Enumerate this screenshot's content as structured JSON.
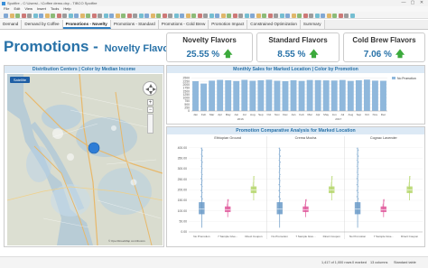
{
  "window": {
    "title": "Spotfire - C:\\Users\\...\\Coffee demo.dxp - TIBCO Spotfire",
    "controls": [
      "—",
      "▢",
      "✕"
    ]
  },
  "menu": [
    "File",
    "Edit",
    "View",
    "Insert",
    "Tools",
    "Help"
  ],
  "tabs": [
    {
      "label": "Demand"
    },
    {
      "label": "Demand by Coffee"
    },
    {
      "label": "Promotions - Novelty"
    },
    {
      "label": "Promotions - Standard"
    },
    {
      "label": "Promotions - Cold Brew"
    },
    {
      "label": "Promotion Impact"
    },
    {
      "label": "Constrained Optimization"
    },
    {
      "label": "Summary"
    }
  ],
  "page": {
    "title": "Promotions - ",
    "subtitle": "Novelty Flavors"
  },
  "kpis": [
    {
      "label": "Novelty Flavors",
      "value": "25.55 %"
    },
    {
      "label": "Standard Flavors",
      "value": "8.55 %"
    },
    {
      "label": "Cold Brew Flavors",
      "value": "7.06 %"
    }
  ],
  "map": {
    "title": "Distribution Centers | Color by Median Income",
    "layer_button": "Satellite",
    "attribution": "© OpenStreetMap contributors"
  },
  "sales_panel": {
    "title": "Monthly Sales for Marked Location | Color by Promotion"
  },
  "box_panel": {
    "title": "Promotion Comparative Analysis for Marked Location"
  },
  "chart_data": [
    {
      "type": "bar",
      "categories": [
        "Jan",
        "Feb",
        "Mar",
        "Apr",
        "May",
        "Jun",
        "Jul",
        "Aug",
        "Sep",
        "Oct",
        "Nov",
        "Dec",
        "Jan",
        "Feb",
        "Mar",
        "Apr",
        "May",
        "Jun",
        "Jul",
        "Aug",
        "Sep",
        "Oct",
        "Nov",
        "Dec"
      ],
      "year_labels": [
        "2016",
        "2017"
      ],
      "values": [
        2260,
        2080,
        2300,
        2360,
        2330,
        2270,
        2360,
        2290,
        2330,
        2370,
        2290,
        2260,
        2330,
        2280,
        2350,
        2340,
        2320,
        2310,
        2350,
        2280,
        2330,
        2380,
        2300,
        2290
      ],
      "yticks": [
        0,
        250,
        500,
        750,
        1000,
        1250,
        1500,
        1750,
        2000,
        2250,
        2500
      ],
      "ylim": [
        0,
        2600
      ],
      "legend": "No Promotion",
      "bar_color": "#8fb8dc"
    },
    {
      "type": "box",
      "groups": [
        {
          "name": "Ethiopian Ground",
          "boxes": [
            {
              "label": "No Promotion",
              "color": "#6a9bc8",
              "whisker_low": 20,
              "q1": 85,
              "median": 108,
              "q3": 140,
              "whisker_high": 400
            },
            {
              "label": "7 Sample Give...",
              "color": "#e0559a",
              "whisker_low": 70,
              "q1": 95,
              "median": 106,
              "q3": 120,
              "whisker_high": 155
            },
            {
              "label": "Direct Coupon",
              "color": "#b5d66a",
              "whisker_low": 150,
              "q1": 185,
              "median": 200,
              "q3": 215,
              "whisker_high": 265
            }
          ]
        },
        {
          "name": "Crema Mocha",
          "boxes": [
            {
              "label": "No Promotion",
              "color": "#6a9bc8",
              "whisker_low": 20,
              "q1": 85,
              "median": 108,
              "q3": 140,
              "whisker_high": 400
            },
            {
              "label": "7 Sample Give...",
              "color": "#e0559a",
              "whisker_low": 70,
              "q1": 95,
              "median": 106,
              "q3": 120,
              "whisker_high": 155
            },
            {
              "label": "Direct Coupon",
              "color": "#b5d66a",
              "whisker_low": 150,
              "q1": 185,
              "median": 200,
              "q3": 215,
              "whisker_high": 265
            }
          ]
        },
        {
          "name": "Cognac Lavender",
          "boxes": [
            {
              "label": "No Promotion",
              "color": "#6a9bc8",
              "whisker_low": 20,
              "q1": 85,
              "median": 108,
              "q3": 140,
              "whisker_high": 400
            },
            {
              "label": "7 Sample Give...",
              "color": "#e0559a",
              "whisker_low": 70,
              "q1": 95,
              "median": 106,
              "q3": 120,
              "whisker_high": 155
            },
            {
              "label": "Direct Coupon",
              "color": "#b5d66a",
              "whisker_low": 150,
              "q1": 185,
              "median": 200,
              "q3": 215,
              "whisker_high": 265
            }
          ]
        }
      ],
      "yticks": [
        0,
        50,
        100,
        150,
        200,
        250,
        300,
        350,
        400
      ],
      "ylim": [
        0,
        420
      ]
    }
  ],
  "status": {
    "rows": "1,417 of 1,000 rows",
    "marked": "0 marked",
    "columns": "13 columns",
    "filter": "Standard table"
  }
}
